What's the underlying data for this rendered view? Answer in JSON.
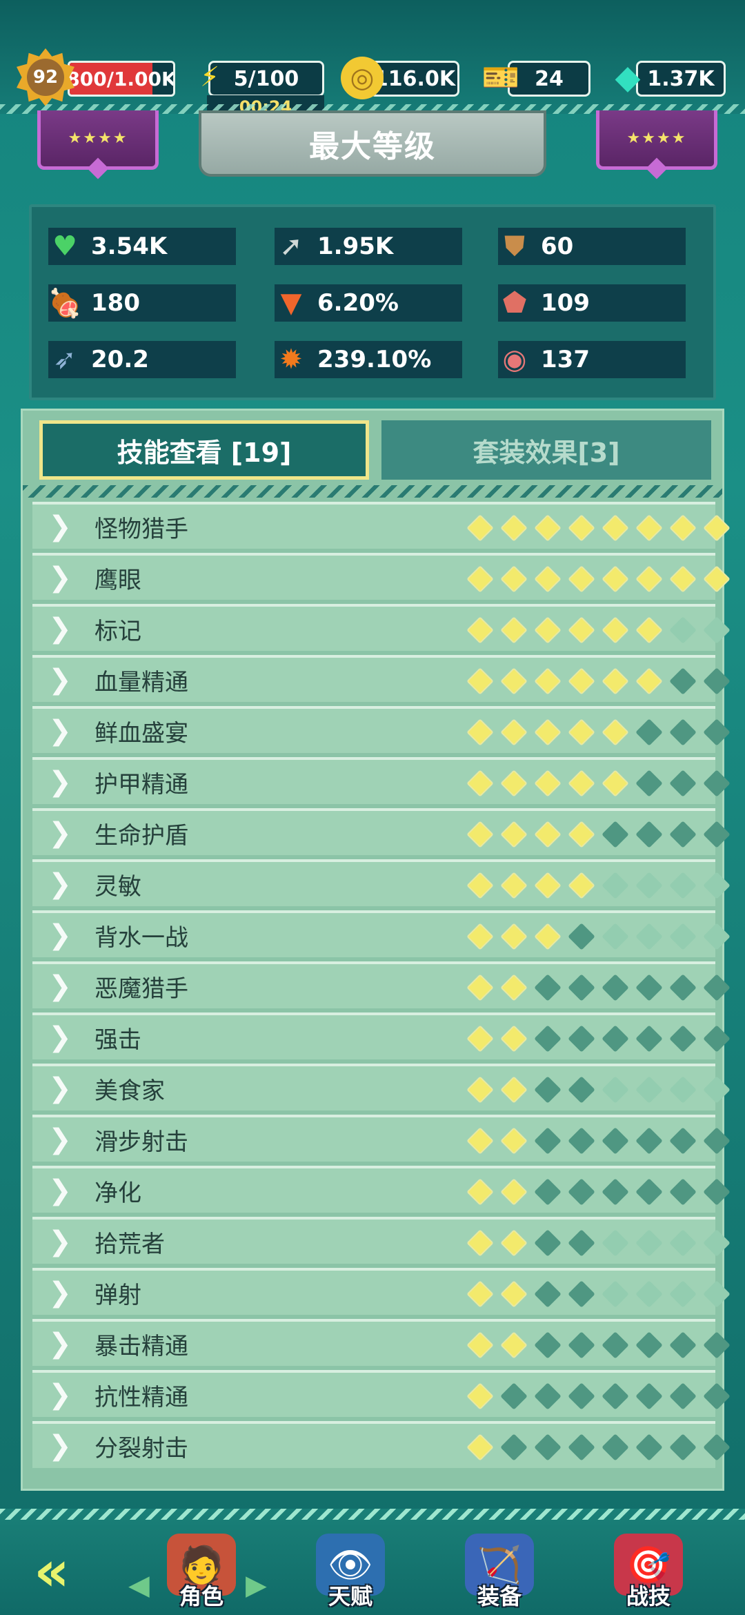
{
  "topbar": {
    "level": "92",
    "xp": {
      "text": "800/1.00K",
      "fraction": 0.8
    },
    "energy": "5/100",
    "energy_timer": "00:24",
    "coins": "116.0K",
    "tickets": "24",
    "gems": "1.37K"
  },
  "header": {
    "title": "最大等级",
    "left_card_stars": "★★★★",
    "right_card_stars": "★★★★"
  },
  "stats": [
    {
      "icon": "heart-icon",
      "value": "3.54K",
      "color": "#4bd267"
    },
    {
      "icon": "spear-icon",
      "value": "1.95K",
      "color": "#cfd8d6"
    },
    {
      "icon": "shield-icon",
      "value": "60",
      "color": "#c98d4b"
    },
    {
      "icon": "meat-icon",
      "value": "180",
      "color": "#d96a6a"
    },
    {
      "icon": "fox-icon",
      "value": "6.20%",
      "color": "#f0662c"
    },
    {
      "icon": "crown-icon",
      "value": "109",
      "color": "#e07064"
    },
    {
      "icon": "bow-icon",
      "value": "20.2",
      "color": "#8fb3d6"
    },
    {
      "icon": "burst-icon",
      "value": "239.10%",
      "color": "#f27a1d"
    },
    {
      "icon": "target-icon",
      "value": "137",
      "color": "#e57777"
    }
  ],
  "tabs": {
    "skills": "技能查看 [19]",
    "sets": "套装效果[3]"
  },
  "skills": [
    {
      "name": "怪物猎手",
      "on": 8,
      "off": 0
    },
    {
      "name": "鹰眼",
      "on": 8,
      "off": 0
    },
    {
      "name": "标记",
      "on": 6,
      "off": 0
    },
    {
      "name": "血量精通",
      "on": 6,
      "off": 2
    },
    {
      "name": "鲜血盛宴",
      "on": 5,
      "off": 3
    },
    {
      "name": "护甲精通",
      "on": 5,
      "off": 3
    },
    {
      "name": "生命护盾",
      "on": 4,
      "off": 4
    },
    {
      "name": "灵敏",
      "on": 4,
      "off": 0
    },
    {
      "name": "背水一战",
      "on": 3,
      "off": 1
    },
    {
      "name": "恶魔猎手",
      "on": 2,
      "off": 6
    },
    {
      "name": "强击",
      "on": 2,
      "off": 6
    },
    {
      "name": "美食家",
      "on": 2,
      "off": 2
    },
    {
      "name": "滑步射击",
      "on": 2,
      "off": 6
    },
    {
      "name": "净化",
      "on": 2,
      "off": 6
    },
    {
      "name": "拾荒者",
      "on": 2,
      "off": 2
    },
    {
      "name": "弹射",
      "on": 2,
      "off": 2
    },
    {
      "name": "暴击精通",
      "on": 2,
      "off": 6
    },
    {
      "name": "抗性精通",
      "on": 1,
      "off": 7
    },
    {
      "name": "分裂射击",
      "on": 1,
      "off": 7
    }
  ],
  "nav": {
    "character": "角色",
    "talent": "天赋",
    "equipment": "装备",
    "skill": "战技"
  }
}
